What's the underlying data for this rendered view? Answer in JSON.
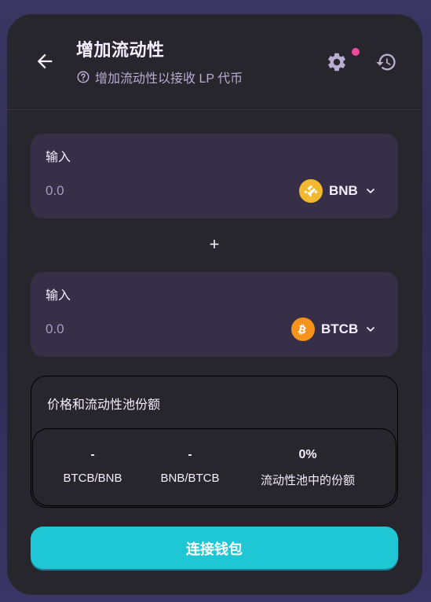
{
  "header": {
    "title": "增加流动性",
    "subtitle": "增加流动性以接收 LP 代币"
  },
  "inputs": [
    {
      "label": "输入",
      "amount_placeholder": "0.0",
      "token": "BNB",
      "token_color": "#f3ba2f"
    },
    {
      "label": "输入",
      "amount_placeholder": "0.0",
      "token": "BTCB",
      "token_color": "#f7931a"
    }
  ],
  "plus_symbol": "+",
  "pool": {
    "title": "价格和流动性池份额",
    "stats": [
      {
        "value": "-",
        "label": "BTCB/BNB"
      },
      {
        "value": "-",
        "label": "BNB/BTCB"
      },
      {
        "value": "0%",
        "label": "流动性池中的份额"
      }
    ]
  },
  "connect_button": {
    "label": "连接钱包"
  },
  "colors": {
    "accent": "#1fc7d4",
    "card_bg": "#27262c",
    "input_bg": "#372f47",
    "text_primary": "#f4eeff",
    "text_secondary": "#b8add2",
    "notification": "#ed4b9e"
  },
  "icons": {
    "back": "arrow-left-icon",
    "help": "question-circle-icon",
    "settings": "gear-icon",
    "history": "history-icon",
    "dropdown": "chevron-down-icon"
  }
}
